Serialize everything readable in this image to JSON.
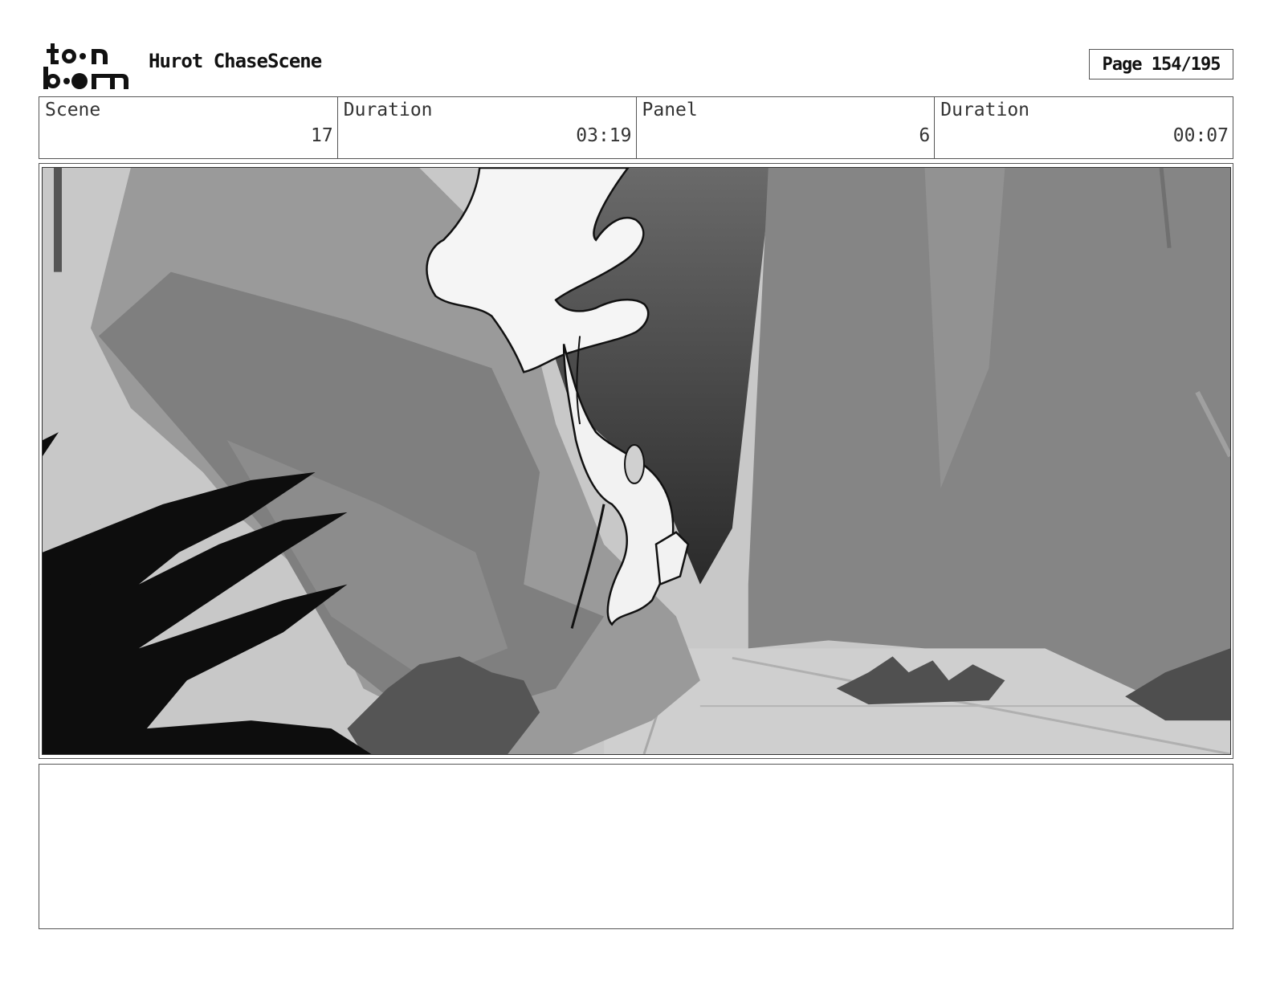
{
  "header": {
    "logo_icon": "toon-boom-logo",
    "project_title": "Hurot ChaseScene",
    "page_label": "Page 154/195"
  },
  "info": {
    "scene_label": "Scene",
    "scene_value": "17",
    "scene_duration_label": "Duration",
    "scene_duration_value": "03:19",
    "panel_label": "Panel",
    "panel_value": "6",
    "panel_duration_label": "Duration",
    "panel_duration_value": "00:07"
  },
  "panel": {
    "image_icon": "storyboard-sketch-image"
  },
  "notes": {
    "text": ""
  }
}
